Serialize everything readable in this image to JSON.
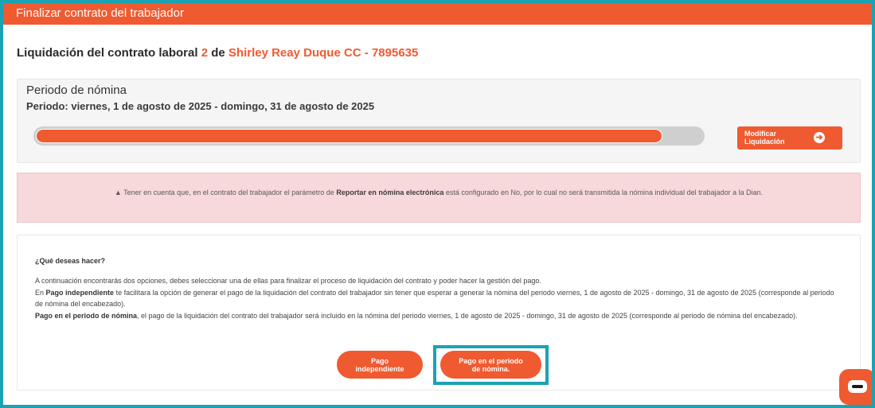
{
  "modal": {
    "title": "Finalizar contrato del trabajador"
  },
  "contract": {
    "prefix": "Liquidación del contrato laboral",
    "number": "2",
    "of": "de",
    "employee": "Shirley Reay Duque CC - 7895635"
  },
  "period": {
    "title": "Periodo de nómina",
    "range": "Periodo: viernes, 1 de agosto de 2025 - domingo, 31 de agosto de 2025",
    "progress_percent": 94,
    "modify_button_line1": "Modificar",
    "modify_button_line2": "Liquidación",
    "modify_icon": "arrow-right-circle-icon"
  },
  "alert": {
    "icon": "warning-triangle-icon",
    "text_before": "Tener en cuenta que, en el contrato del trabajador el parámetro de",
    "bold": "Reportar en nómina electrónica",
    "text_after": "está configurado en No, por lo cual no será transmitida la nómina individual del trabajador a la Dian."
  },
  "actions": {
    "question": "¿Qué deseas hacer?",
    "intro": "A continuación encontrarás dos opciones, debes seleccionar una de ellas para finalizar el proceso de liquidación del contrato y poder hacer la gestión del pago.",
    "independent_prefix": "En",
    "independent_bold": "Pago independiente",
    "independent_text": "te facilitara la opción de generar el pago de la liquidación del contrato del trabajador sin tener que esperar a generar la nómina del periodo viernes, 1 de agosto de 2025 - domingo, 31 de agosto de 2025 (corresponde al periodo de nómina del encabezado).",
    "period_bold": "Pago en el periodo de nómina",
    "period_text": ", el pago de la liquidación del contrato del trabajador será incluido en la nómina del periodo viernes, 1 de agosto de 2025 - domingo, 31 de agosto de 2025 (corresponde al periodo de nómina del encabezado).",
    "btn_independent_line1": "Pago",
    "btn_independent_line2": "independiente",
    "btn_period_line1": "Pago en el periodo",
    "btn_period_line2": "de nómina."
  },
  "chat": {
    "icon": "chat-bubble-icon"
  },
  "colors": {
    "accent": "#f05a30",
    "highlight": "#1aa3b3",
    "alert_bg": "#f7d8db"
  }
}
